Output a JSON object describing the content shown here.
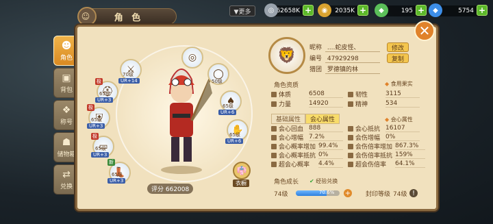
{
  "header": {
    "title": "角 色",
    "more_label": "▼更多",
    "currencies": [
      {
        "icon": "silver-coin-icon",
        "value": "62658K"
      },
      {
        "icon": "gold-coin-icon",
        "value": "2035K"
      },
      {
        "icon": "green-gem-icon",
        "value": "195"
      },
      {
        "icon": "blue-gem-icon",
        "value": "5754"
      }
    ]
  },
  "sidebar": {
    "items": [
      {
        "label": "角色",
        "icon": "character-icon",
        "active": true
      },
      {
        "label": "背包",
        "icon": "bag-icon",
        "active": false
      },
      {
        "label": "称号",
        "icon": "title-icon",
        "active": false
      },
      {
        "label": "储物箱",
        "icon": "storage-icon",
        "active": false
      },
      {
        "label": "兑换",
        "icon": "exchange-icon",
        "active": false
      }
    ]
  },
  "equipment": [
    {
      "level": "70级",
      "enh": "UR+14",
      "rank": ""
    },
    {
      "level": "50级",
      "enh": "",
      "rank": ""
    },
    {
      "level": "65级",
      "enh": "UR+3",
      "rank": "极"
    },
    {
      "level": "65级",
      "enh": "UR+6",
      "rank": ""
    },
    {
      "level": "65级",
      "enh": "UR+3",
      "rank": "极"
    },
    {
      "level": "65级",
      "enh": "UR+6",
      "rank": ""
    },
    {
      "level": "65级",
      "enh": "UR+3",
      "rank": "极"
    },
    {
      "level": "65级",
      "enh": "UR+3",
      "rank": "新"
    }
  ],
  "score": "评分 662008",
  "costume_label": "衣橱",
  "profile": {
    "nickname_label": "昵称",
    "nickname": "....蛇皮怪、",
    "id_label": "编号",
    "id": "47929298",
    "guild_label": "猎团",
    "guild": "罗德镇的林",
    "edit_label": "修改",
    "copy_label": "复制"
  },
  "aptitude": {
    "title": "角色资质",
    "food_label": "食用果实",
    "stats": [
      {
        "label": "体质",
        "value": "6508"
      },
      {
        "label": "韧性",
        "value": "3115"
      },
      {
        "label": "力量",
        "value": "14920"
      },
      {
        "label": "精神",
        "value": "534"
      }
    ]
  },
  "attr_tabs": {
    "basic": "基础属性",
    "crit": "会心属性",
    "crit_link": "会心属性"
  },
  "crit_stats": [
    {
      "label": "会心回血",
      "value": "888"
    },
    {
      "label": "会心抵抗",
      "value": "16107"
    },
    {
      "label": "会心增幅",
      "value": "7.2%"
    },
    {
      "label": "会伤增幅",
      "value": "0%"
    },
    {
      "label": "会心概率增加",
      "value": "99.4%"
    },
    {
      "label": "会伤倍率增加",
      "value": "867.3%"
    },
    {
      "label": "会心概率抵抗",
      "value": "0%"
    },
    {
      "label": "会伤倍率抵抗",
      "value": "159%"
    },
    {
      "label": "超会心概率",
      "value": "4.4%"
    },
    {
      "label": "超会伤倍率",
      "value": "64.1%"
    }
  ],
  "growth": {
    "title": "角色成长",
    "exp_label": "经验兑换",
    "level": "74级",
    "progress_text": "70.6%",
    "progress": 70.6,
    "seal_label": "封印等级",
    "seal_level": "74级"
  },
  "colors": {
    "accent": "#f0b44a",
    "panel": "#f1e1be",
    "border": "#8b6a40"
  }
}
